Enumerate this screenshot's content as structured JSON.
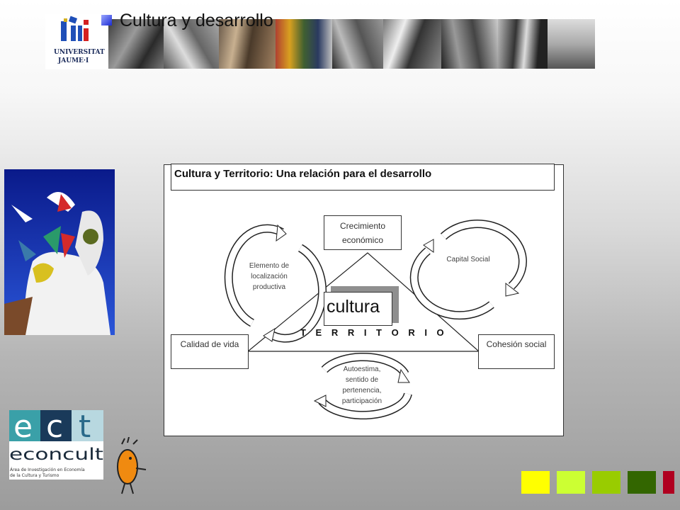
{
  "header": {
    "title": "Cultura y desarrollo",
    "university_logo_text": [
      "UNIVERSITAT",
      "JAUME·I"
    ]
  },
  "diagram": {
    "title": "Cultura y Territorio: Una relación para el desarrollo",
    "nodes": {
      "top": [
        "Crecimiento",
        "económico"
      ],
      "left": "Calidad de vida",
      "right": "Cohesión social",
      "center": "cultura",
      "base": "T E R R I T O R I O"
    },
    "cycles": {
      "left": [
        "Elemento de",
        "localización",
        "productiva"
      ],
      "right": "Capital Social",
      "bottom": [
        "Autoestima,",
        "sentido de",
        "pertenencia,",
        "participación"
      ]
    }
  },
  "econcult": {
    "letters": [
      "e",
      "c",
      "t"
    ],
    "name": "econcult",
    "subtitle": [
      "Área de Investigación en Economía",
      "de la Cultura y Turismo"
    ]
  },
  "colors": {
    "block_1": "#ffff00",
    "block_2": "#ccff33",
    "block_3": "#99cc00",
    "block_4": "#336600",
    "block_5": "#b00020"
  }
}
